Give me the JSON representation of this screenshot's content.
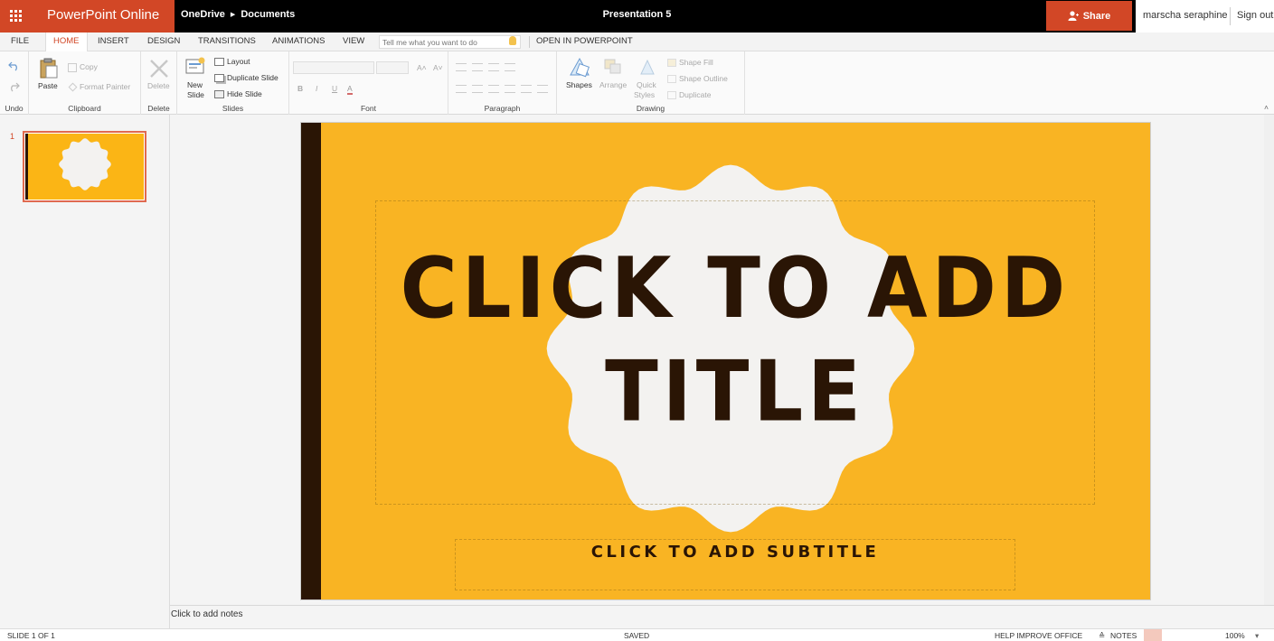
{
  "header": {
    "app_name": "PowerPoint Online",
    "breadcrumb": [
      "OneDrive",
      "Documents"
    ],
    "doc_title": "Presentation 5",
    "share_label": "Share",
    "user_name": "marscha seraphine",
    "sign_out_label": "Sign out"
  },
  "tabs": {
    "items": [
      "FILE",
      "HOME",
      "INSERT",
      "DESIGN",
      "TRANSITIONS",
      "ANIMATIONS",
      "VIEW"
    ],
    "active": "HOME",
    "tell_me_placeholder": "Tell me what you want to do",
    "open_in_app": "OPEN IN POWERPOINT"
  },
  "ribbon": {
    "undo": {
      "label": "Undo"
    },
    "clipboard": {
      "label": "Clipboard",
      "paste": "Paste",
      "copy": "Copy",
      "format_painter": "Format Painter"
    },
    "delete": {
      "label": "Delete",
      "button": "Delete"
    },
    "slides": {
      "label": "Slides",
      "new_slide_1": "New",
      "new_slide_2": "Slide",
      "layout": "Layout",
      "duplicate": "Duplicate Slide",
      "hide": "Hide Slide"
    },
    "font": {
      "label": "Font",
      "bold": "B",
      "italic": "I",
      "underline": "U",
      "color": "A"
    },
    "paragraph": {
      "label": "Paragraph"
    },
    "drawing": {
      "label": "Drawing",
      "shapes": "Shapes",
      "arrange": "Arrange",
      "quick_styles_1": "Quick",
      "quick_styles_2": "Styles",
      "shape_fill": "Shape Fill",
      "shape_outline": "Shape Outline",
      "duplicate": "Duplicate"
    }
  },
  "slides_panel": {
    "slide_number": "1"
  },
  "slide": {
    "title_line1": "CLICK TO ADD",
    "title_line2": "TITLE",
    "subtitle": "CLICK TO ADD SUBTITLE"
  },
  "notes": {
    "placeholder": "Click to add notes"
  },
  "status": {
    "slide_count": "SLIDE 1 OF 1",
    "saved": "SAVED",
    "help": "HELP IMPROVE OFFICE",
    "notes": "NOTES",
    "zoom": "100%"
  },
  "colors": {
    "brand": "#d24726",
    "slide_bg": "#f9b423",
    "slide_dark": "#2a1505",
    "badge": "#f3f2f0"
  }
}
